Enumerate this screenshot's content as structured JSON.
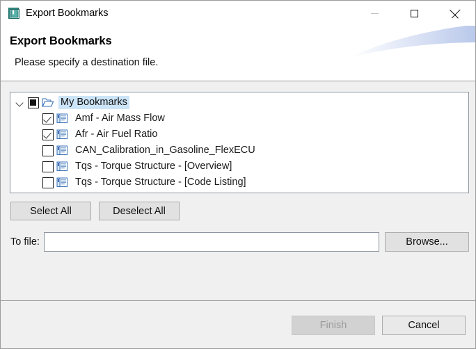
{
  "window": {
    "title": "Export Bookmarks",
    "icon": "bookmarks-export-icon",
    "controls": {
      "minimize": "minimize-icon",
      "maximize": "maximize-icon",
      "close": "close-icon"
    }
  },
  "header": {
    "title": "Export Bookmarks",
    "subtitle": "Please specify a destination file."
  },
  "tree": {
    "root": {
      "label": "My Bookmarks",
      "icon": "open-folder-icon",
      "checkbox_state": "partial",
      "expanded": true,
      "selected": true
    },
    "items": [
      {
        "label": "Amf - Air Mass Flow",
        "icon": "bookmark-document-icon",
        "checked": true
      },
      {
        "label": "Afr - Air Fuel Ratio",
        "icon": "bookmark-document-icon",
        "checked": true
      },
      {
        "label": "CAN_Calibration_in_Gasoline_FlexECU",
        "icon": "bookmark-document-icon",
        "checked": false
      },
      {
        "label": "Tqs - Torque Structure - [Overview]",
        "icon": "bookmark-document-icon",
        "checked": false
      },
      {
        "label": "Tqs - Torque Structure - [Code Listing]",
        "icon": "bookmark-document-icon",
        "checked": false
      }
    ]
  },
  "selection_buttons": {
    "select_all": "Select All",
    "deselect_all": "Deselect All"
  },
  "destination": {
    "label": "To file:",
    "value": "",
    "placeholder": "",
    "browse": "Browse..."
  },
  "footer": {
    "finish": "Finish",
    "finish_enabled": false,
    "cancel": "Cancel",
    "cancel_enabled": true
  },
  "colors": {
    "selection_highlight": "#cce4f7",
    "dialog_background": "#f0f0f0",
    "banner_background": "#ffffff",
    "swoosh_accent": "#c7d4ef",
    "border": "#8d949d",
    "disabled_text": "#9a9a9a"
  }
}
